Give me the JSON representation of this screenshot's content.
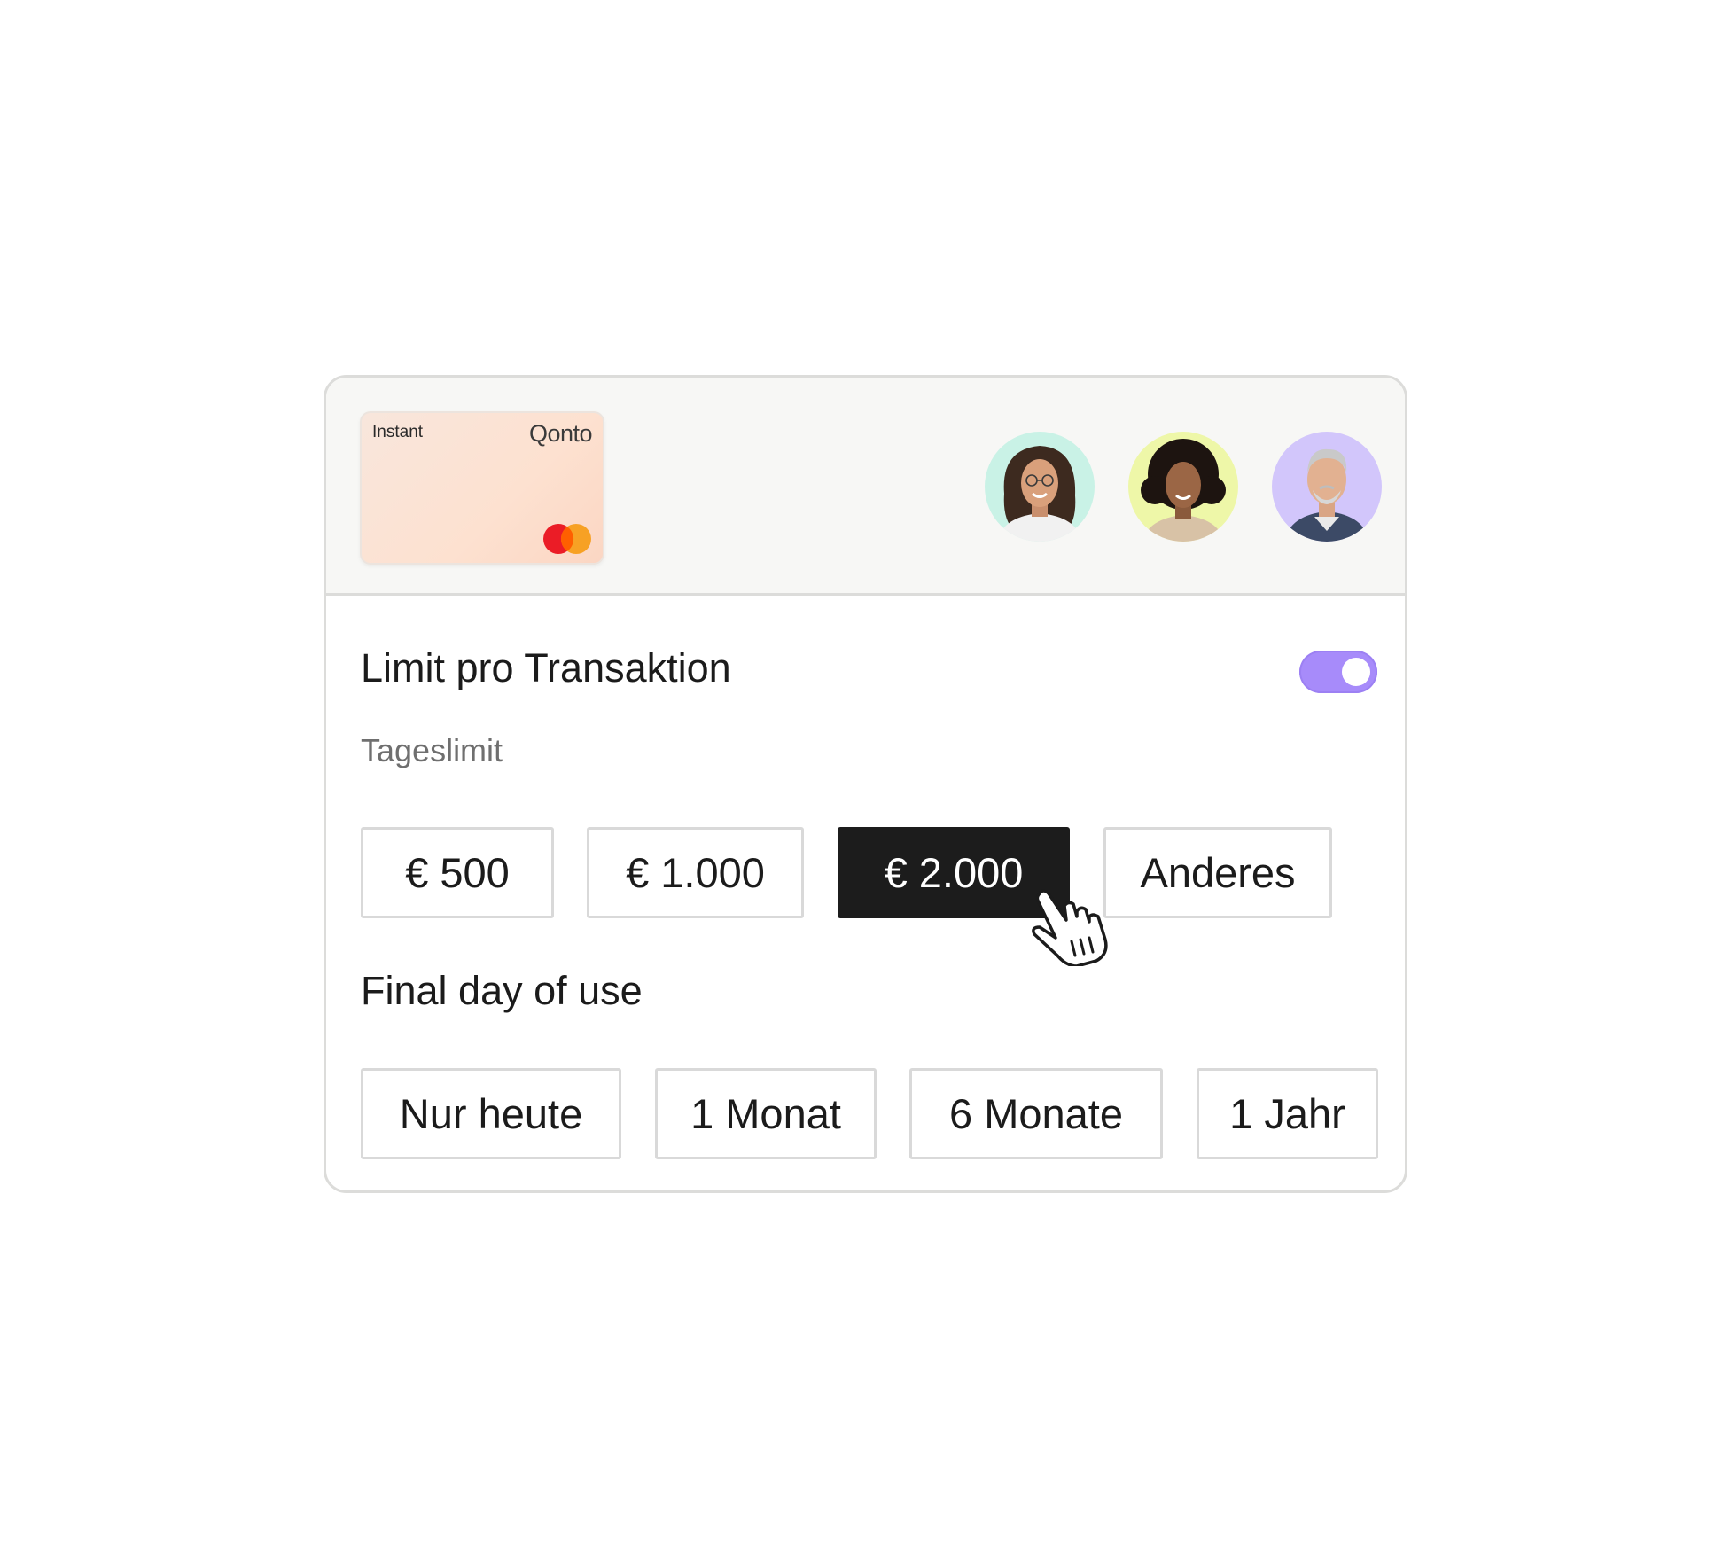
{
  "card": {
    "type_label": "Instant",
    "brand": "Qonto",
    "network_icon": "mastercard-logo"
  },
  "team": {
    "avatars": [
      {
        "name": "avatar-woman-glasses",
        "bg": "#c9f2e6"
      },
      {
        "name": "avatar-woman-curly",
        "bg": "#eef7a8"
      },
      {
        "name": "avatar-man-grey",
        "bg": "#d2c6fb"
      }
    ]
  },
  "limit": {
    "title": "Limit pro Transaktion",
    "toggle_on": true,
    "toggle_color": "#a78bfa",
    "subtitle": "Tageslimit",
    "options": [
      "€ 500",
      "€ 1.000",
      "€ 2.000",
      "Anderes"
    ],
    "selected": "€ 2.000"
  },
  "duration": {
    "title": "Final day of use",
    "options": [
      "Nur heute",
      "1 Monat",
      "6 Monate",
      "1 Jahr"
    ]
  }
}
